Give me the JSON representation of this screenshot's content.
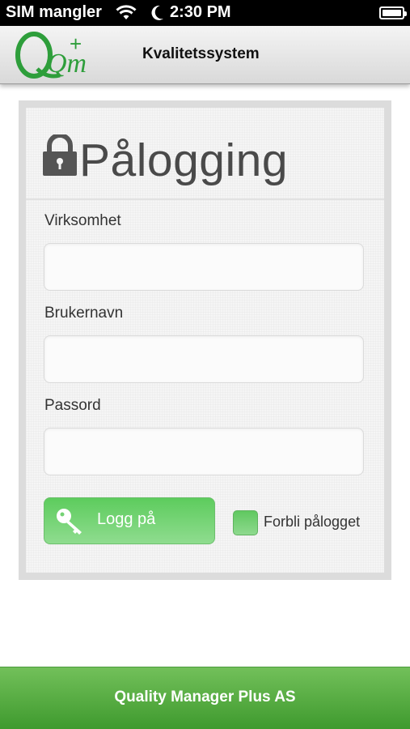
{
  "status_bar": {
    "carrier": "SIM mangler",
    "time": "2:30 PM",
    "icons": [
      "wifi-icon",
      "moon-icon",
      "battery-icon"
    ]
  },
  "header": {
    "title": "Kvalitetssystem",
    "logo_text": "Qm",
    "logo_plus": "+"
  },
  "login": {
    "title": "Pålogging",
    "fields": [
      {
        "label": "Virksomhet",
        "value": "",
        "placeholder": ""
      },
      {
        "label": "Brukernavn",
        "value": "",
        "placeholder": ""
      },
      {
        "label": "Passord",
        "value": "",
        "placeholder": ""
      }
    ],
    "submit_label": "Logg på",
    "remember_label": "Forbli pålogget"
  },
  "footer": {
    "text": "Quality Manager Plus AS"
  },
  "colors": {
    "accent_green": "#5dcc5d",
    "footer_green": "#4fa83c",
    "logo_green": "#2e9e3b"
  }
}
